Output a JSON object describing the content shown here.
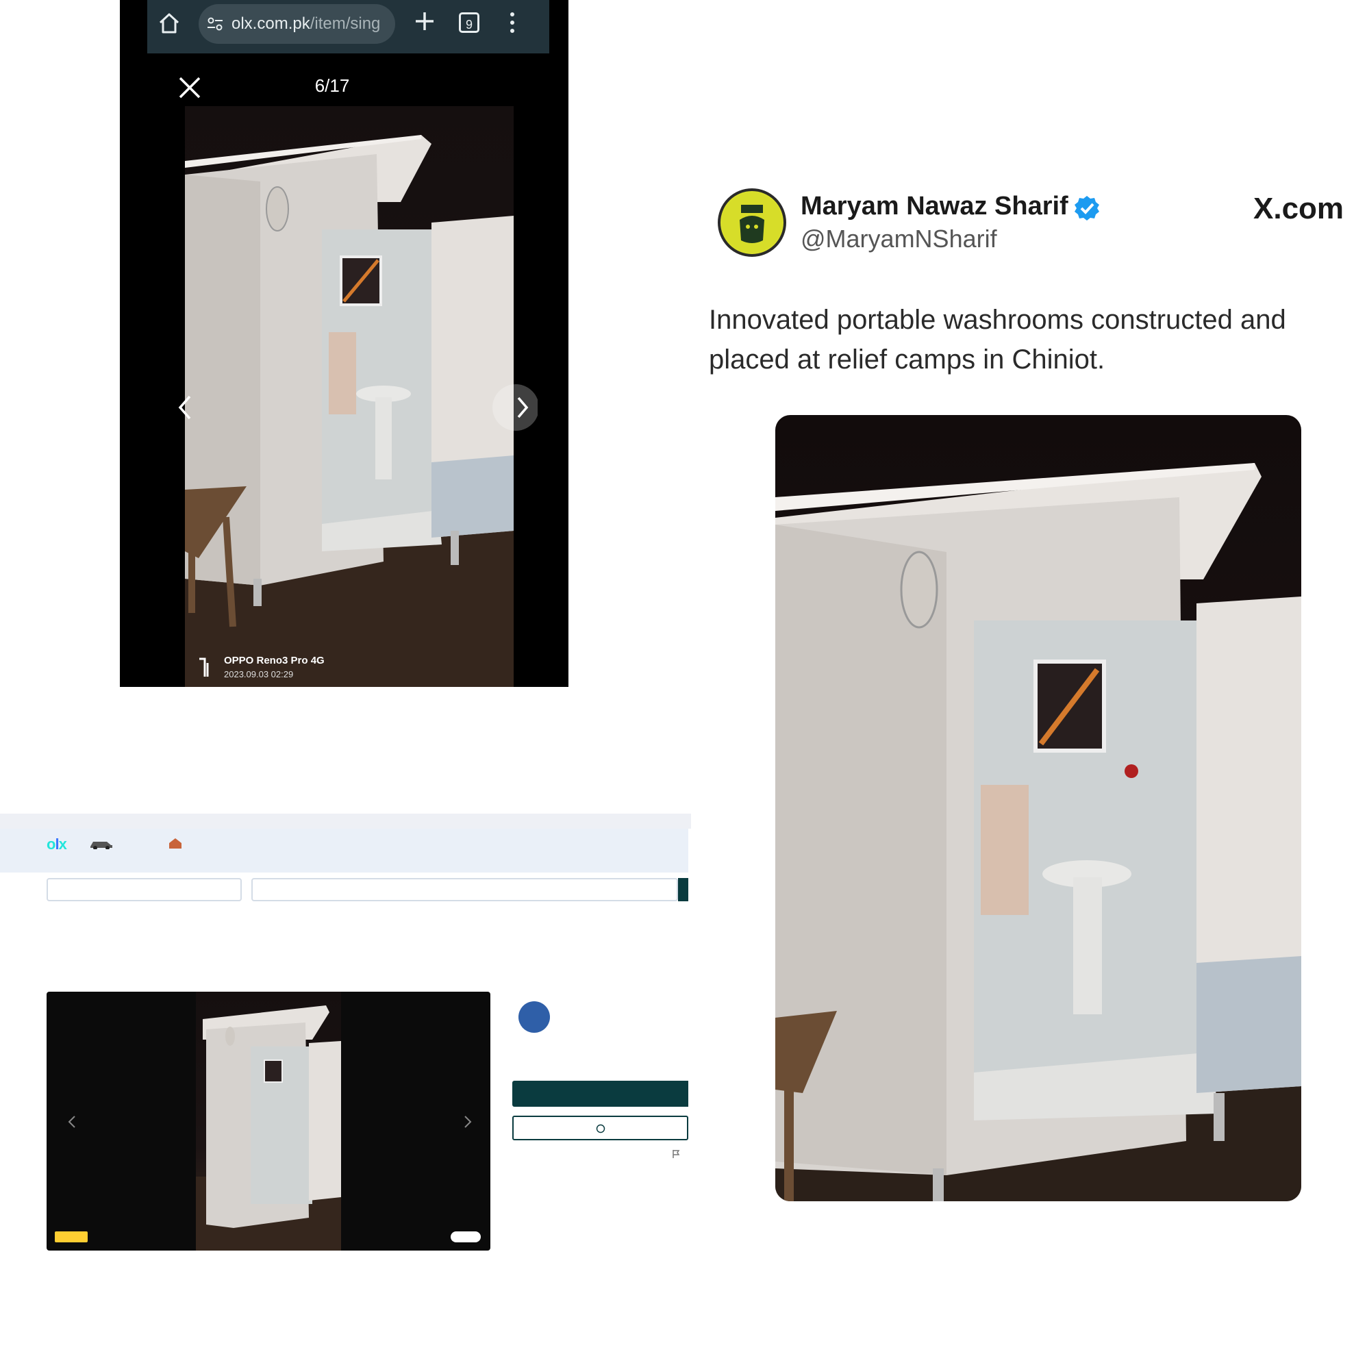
{
  "mobile_browser": {
    "url_host": "olx.com.pk",
    "url_path": "/item/sing",
    "tab_count": "9",
    "photo_counter": "6/17",
    "camera_model": "OPPO Reno3 Pro 4G",
    "camera_timestamp": "2023.09.03 02:29",
    "icons": [
      "home-icon",
      "tune-icon",
      "plus-icon",
      "tabs-icon",
      "menu-icon",
      "close-icon",
      "chevron-left-icon",
      "chevron-right-icon"
    ]
  },
  "tweet": {
    "display_name": "Maryam Nawaz Sharif",
    "handle": "@MaryamNSharif",
    "source_label": "X.com",
    "text": "Innovated portable washrooms constructed and placed at relief camps in Chiniot.",
    "verified_color": "#1d9bf0"
  },
  "olx_desktop": {
    "brand_colors": {
      "accent": "#23e5db",
      "dark": "#0a3b3f"
    }
  }
}
